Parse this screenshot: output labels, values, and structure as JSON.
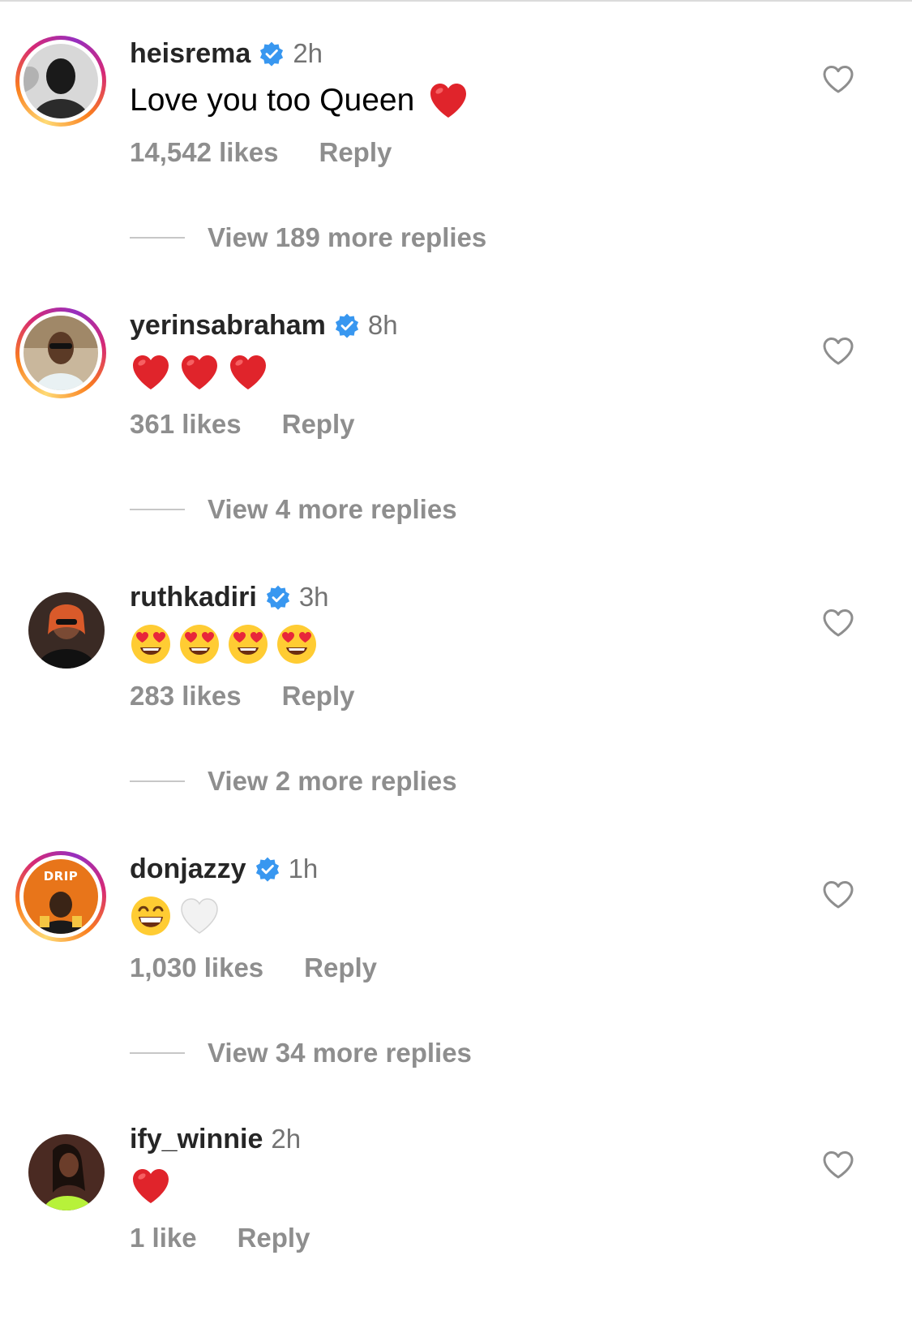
{
  "comments": [
    {
      "username": "heisrema",
      "verified": true,
      "time": "2h",
      "text": "Love you too Queen",
      "emojis": [
        "red-heart"
      ],
      "likes": "14,542 likes",
      "reply_label": "Reply",
      "view_replies": "View 189 more replies",
      "story_ring": true
    },
    {
      "username": "yerinsabraham",
      "verified": true,
      "time": "8h",
      "text": "",
      "emojis": [
        "red-heart",
        "red-heart",
        "red-heart"
      ],
      "likes": "361 likes",
      "reply_label": "Reply",
      "view_replies": "View 4 more replies",
      "story_ring": true
    },
    {
      "username": "ruthkadiri",
      "verified": true,
      "time": "3h",
      "text": "",
      "emojis": [
        "heart-eyes-face",
        "heart-eyes-face",
        "heart-eyes-face",
        "heart-eyes-face"
      ],
      "likes": "283 likes",
      "reply_label": "Reply",
      "view_replies": "View 2 more replies",
      "story_ring": false
    },
    {
      "username": "donjazzy",
      "verified": true,
      "time": "1h",
      "text": "",
      "emojis": [
        "grinning-face",
        "white-heart"
      ],
      "likes": "1,030 likes",
      "reply_label": "Reply",
      "view_replies": "View 34 more replies",
      "story_ring": true,
      "avatar_text": "DRIP"
    },
    {
      "username": "ify_winnie",
      "verified": false,
      "time": "2h",
      "text": "",
      "emojis": [
        "red-heart"
      ],
      "likes": "1 like",
      "reply_label": "Reply",
      "story_ring": false
    }
  ],
  "colors": {
    "text_primary": "#262626",
    "text_secondary": "#8e8e8e",
    "verified_blue": "#3897f0",
    "heart_red": "#e0242b"
  }
}
